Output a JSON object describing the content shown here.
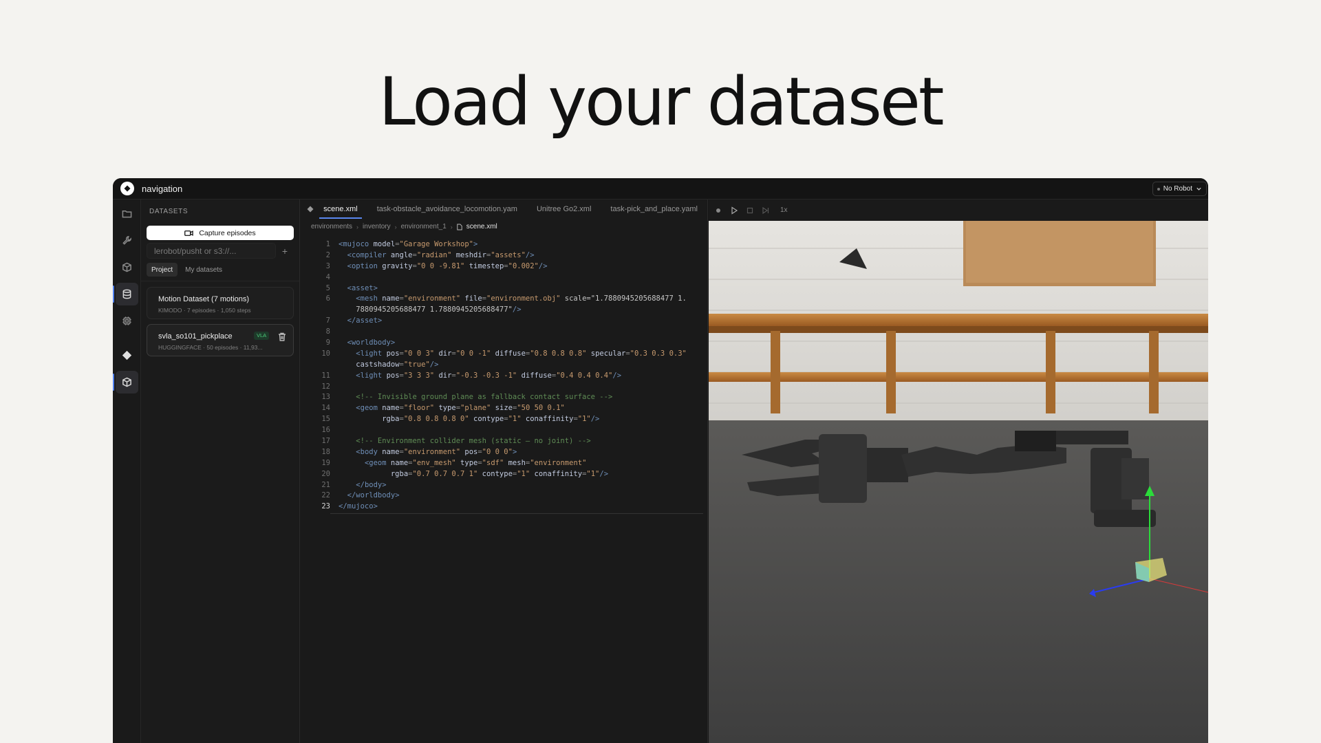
{
  "hero": {
    "title": "Load your dataset"
  },
  "app": {
    "title": "navigation",
    "robot_select": "No Robot"
  },
  "rail": {
    "items": [
      "folder-icon",
      "wrench-icon",
      "cube-icon",
      "database-icon",
      "chip-icon",
      "diamond-icon",
      "box-icon"
    ]
  },
  "datasets": {
    "header": "DATASETS",
    "capture_label": "Capture episodes",
    "search_placeholder": "lerobot/pusht or s3://...",
    "add_label": "+",
    "tabs": [
      "Project",
      "My datasets"
    ],
    "items": [
      {
        "name": "Motion Dataset (7 motions)",
        "meta": "KIMODO · 7 episodes · 1,050 steps"
      },
      {
        "name": "svla_so101_pickplace",
        "badge": "VLA",
        "meta": "HUGGINGFACE · 50 episodes · 11,93..."
      }
    ]
  },
  "editor": {
    "tabs": [
      "scene.xml",
      "task-obstacle_avoidance_locomotion.yam",
      "Unitree Go2.xml",
      "task-pick_and_place.yaml"
    ],
    "breadcrumb": [
      "environments",
      "inventory",
      "environment_1",
      "scene.xml"
    ],
    "current_line": 23,
    "lines": [
      "<mujoco model=\"Garage Workshop\">",
      "  <compiler angle=\"radian\" meshdir=\"assets\"/>",
      "  <option gravity=\"0 0 -9.81\" timestep=\"0.002\"/>",
      "",
      "  <asset>",
      "    <mesh name=\"environment\" file=\"environment.obj\" scale=\"1.7880945205688477 1.",
      "    7880945205688477 1.7880945205688477\"/>",
      "  </asset>",
      "",
      "  <worldbody>",
      "    <light pos=\"0 0 3\" dir=\"0 0 -1\" diffuse=\"0.8 0.8 0.8\" specular=\"0.3 0.3 0.3\"",
      "    castshadow=\"true\"/>",
      "    <light pos=\"3 3 3\" dir=\"-0.3 -0.3 -1\" diffuse=\"0.4 0.4 0.4\"/>",
      "",
      "    <!-- Invisible ground plane as fallback contact surface -->",
      "    <geom name=\"floor\" type=\"plane\" size=\"50 50 0.1\"",
      "          rgba=\"0.8 0.8 0.8 0\" contype=\"1\" conaffinity=\"1\"/>",
      "",
      "    <!-- Environment collider mesh (static — no joint) -->",
      "    <body name=\"environment\" pos=\"0 0 0\">",
      "      <geom name=\"env_mesh\" type=\"sdf\" mesh=\"environment\"",
      "            rgba=\"0.7 0.7 0.7 1\" contype=\"1\" conaffinity=\"1\"/>",
      "    </body>",
      "  </worldbody>",
      "</mujoco>"
    ],
    "line_numbers": [
      "1",
      "2",
      "3",
      "4",
      "5",
      "6",
      "",
      "7",
      "8",
      "9",
      "10",
      "",
      "11",
      "12",
      "13",
      "14",
      "15",
      "16",
      "17",
      "18",
      "19",
      "20",
      "21",
      "22",
      "23"
    ]
  },
  "viewport": {
    "speed": "1x"
  },
  "colors": {
    "accent": "#5a88f0",
    "vla_badge": "#4ccb7a"
  }
}
